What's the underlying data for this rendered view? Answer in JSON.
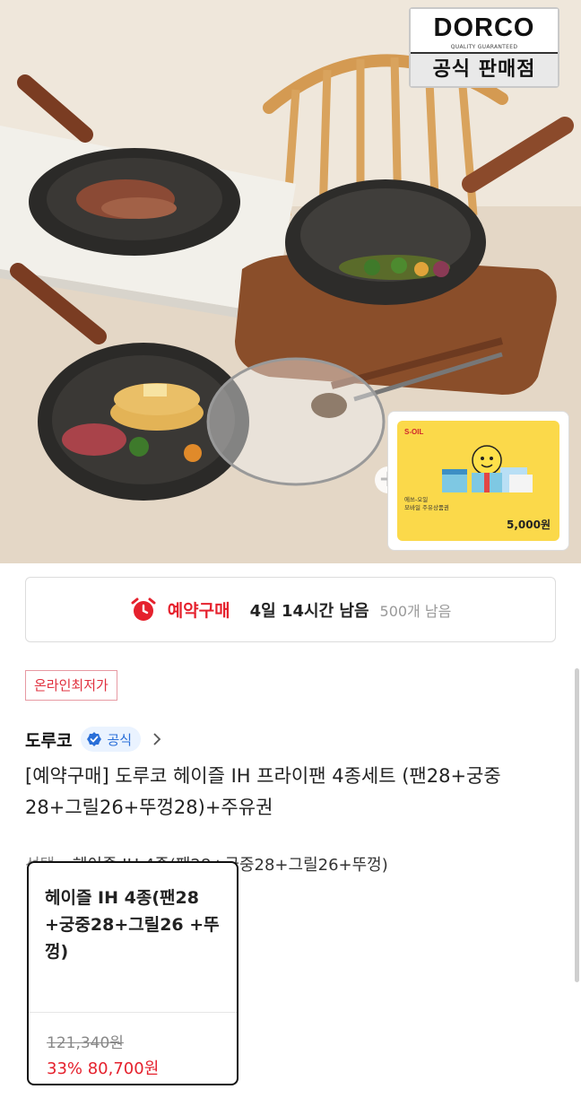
{
  "hero": {
    "brand_badge": {
      "brand": "DORCO",
      "tagline": "QUALITY GUARANTEED",
      "store": "공식 판매점"
    },
    "gift_card": {
      "issuer": "S-OIL",
      "description_line1": "에쓰-오일",
      "description_line2": "모바일 주유상품권",
      "amount": "5,000원"
    }
  },
  "reservation": {
    "label": "예약구매",
    "time_remaining": "4일 14시간 남음",
    "stock_remaining": "500개 남음"
  },
  "badge": {
    "lowest_price": "온라인최저가"
  },
  "seller": {
    "name": "도루코",
    "official_label": "공식"
  },
  "product": {
    "title": "[예약구매] 도루코 헤이즐 IH 프라이팬 4종세트 (팬28+궁중28+그릴26+뚜껑28)+주유권"
  },
  "option": {
    "select_label": "선택",
    "selected_value": "헤이즐 IH 4종(팬28+궁중28+그릴26+뚜껑)",
    "card": {
      "name": "헤이즐 IH 4종(팬28 +궁중28+그릴26 +뚜껑)",
      "original_price": "121,340원",
      "sale_price": "33% 80,700원"
    }
  },
  "colors": {
    "accent_red": "#e5212d",
    "official_blue": "#2a6fd8",
    "card_yellow": "#fbd94a"
  }
}
